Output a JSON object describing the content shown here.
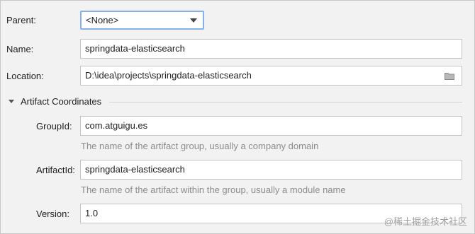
{
  "form": {
    "parent": {
      "label": "Parent:",
      "value": "<None>"
    },
    "name": {
      "label": "Name:",
      "value": "springdata-elasticsearch"
    },
    "location": {
      "label": "Location:",
      "value": "D:\\idea\\projects\\springdata-elasticsearch",
      "icon": "folder-icon"
    },
    "artifact_section": {
      "title": "Artifact Coordinates",
      "group_id": {
        "label": "GroupId:",
        "value": "com.atguigu.es",
        "hint": "The name of the artifact group, usually a company domain"
      },
      "artifact_id": {
        "label": "ArtifactId:",
        "value": "springdata-elasticsearch",
        "hint": "The name of the artifact within the group, usually a module name"
      },
      "version": {
        "label": "Version:",
        "value": "1.0"
      }
    }
  },
  "watermark": "@稀土掘金技术社区",
  "colors": {
    "background": "#f2f2f2",
    "field_border": "#c4c4c4",
    "focus_border": "#86b0e6",
    "hint_text": "#8c8c8c"
  }
}
